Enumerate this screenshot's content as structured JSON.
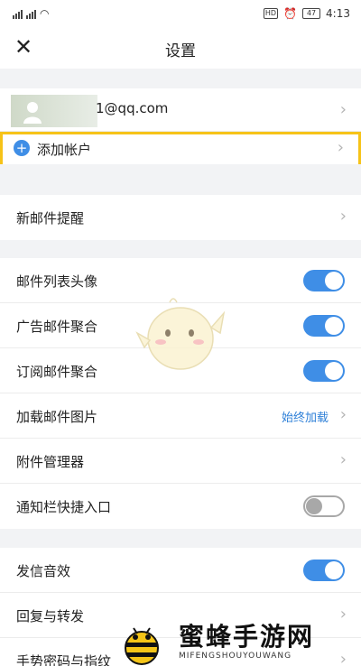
{
  "status_bar": {
    "time": "4:13",
    "battery": "47",
    "network_badge": "HD"
  },
  "header": {
    "title": "设置",
    "close_icon": "close-icon"
  },
  "account": {
    "email": "1@qq.com",
    "add_label": "添加帐户",
    "add_icon": "plus-circle-icon"
  },
  "section_notify": {
    "new_mail_alert": "新邮件提醒"
  },
  "section_display": {
    "items": [
      {
        "label": "邮件列表头像",
        "toggle": true
      },
      {
        "label": "广告邮件聚合",
        "toggle": true
      },
      {
        "label": "订阅邮件聚合",
        "toggle": true
      },
      {
        "label": "加载邮件图片",
        "value": "始终加载"
      },
      {
        "label": "附件管理器"
      },
      {
        "label": "通知栏快捷入口",
        "toggle": false
      }
    ]
  },
  "section_send": {
    "items": [
      {
        "label": "发信音效",
        "toggle": true
      },
      {
        "label": "回复与转发"
      },
      {
        "label": "手势密码与指纹"
      }
    ]
  },
  "watermark": {
    "title": "蜜蜂手游网",
    "subtitle": "MIFENGSHOUYOUWANG"
  },
  "colors": {
    "accent": "#3f8ee6",
    "highlight_border": "#f6c318",
    "background": "#f2f3f5"
  }
}
